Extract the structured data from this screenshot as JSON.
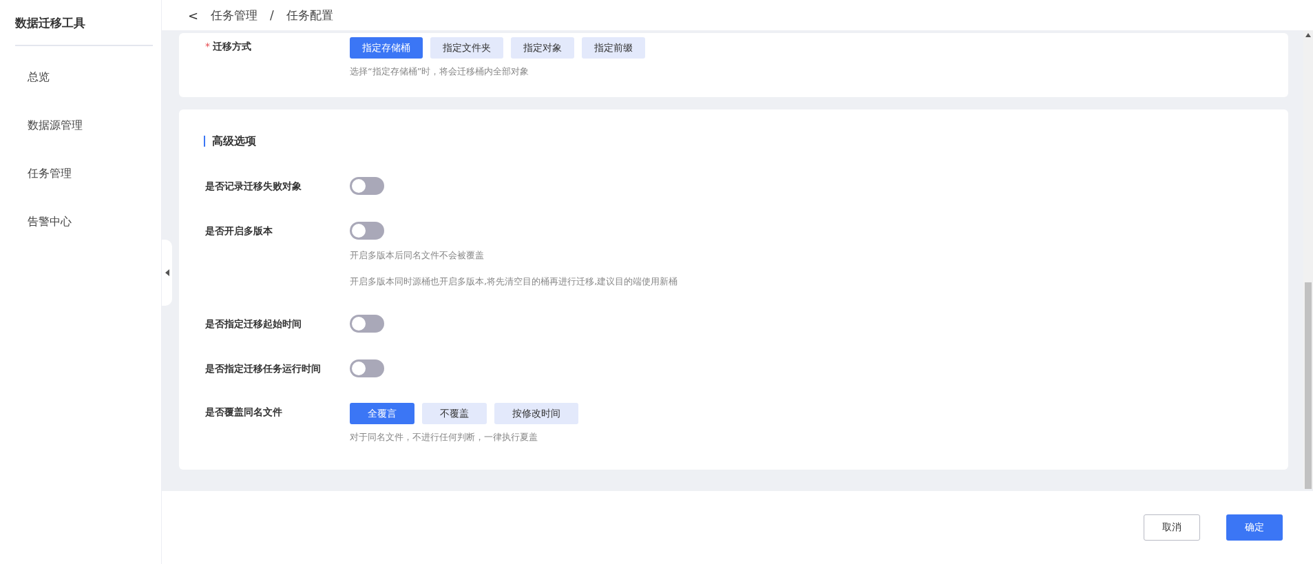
{
  "sidebar": {
    "title": "数据迁移工具",
    "items": [
      {
        "label": "总览"
      },
      {
        "label": "数据源管理"
      },
      {
        "label": "任务管理"
      },
      {
        "label": "告警中心"
      }
    ]
  },
  "header": {
    "back": "<",
    "breadcrumb": [
      "任务管理",
      "任务配置"
    ],
    "separator": "/"
  },
  "migration": {
    "label": "迁移方式",
    "required_mark": "*",
    "options": [
      {
        "label": "指定存储桶",
        "selected": true
      },
      {
        "label": "指定文件夹",
        "selected": false
      },
      {
        "label": "指定对象",
        "selected": false
      },
      {
        "label": "指定前缀",
        "selected": false
      }
    ],
    "hints": [
      "选择“指定存储桶”时，将会迁移桶内全部对象"
    ]
  },
  "advanced": {
    "title": "高级选项",
    "rows": [
      {
        "kind": "toggle",
        "label": "是否记录迁移失败对象",
        "on": false
      },
      {
        "kind": "toggle",
        "label": "是否开启多版本",
        "on": false,
        "hints": [
          "开启多版本后同名文件不会被覆盖",
          "开启多版本同时源桶也开启多版本,将先清空目的桶再进行迁移,建议目的端使用新桶"
        ]
      },
      {
        "kind": "toggle",
        "label": "是否指定迁移起始时间",
        "on": false
      },
      {
        "kind": "toggle",
        "label": "是否指定迁移任务运行时间",
        "on": false
      },
      {
        "kind": "choice",
        "label": "是否覆盖同名文件",
        "options": [
          {
            "label": "全覆言",
            "selected": true
          },
          {
            "label": "不覆盖",
            "selected": false
          },
          {
            "label": "按修改时间",
            "selected": false
          }
        ],
        "hints": [
          "对于同名文件，不进行任何判断，一律执行夏盖"
        ]
      }
    ]
  },
  "footer": {
    "buttons": [
      {
        "label": "取消",
        "kind": "secondary"
      },
      {
        "label": "确定",
        "kind": "primary"
      }
    ]
  }
}
